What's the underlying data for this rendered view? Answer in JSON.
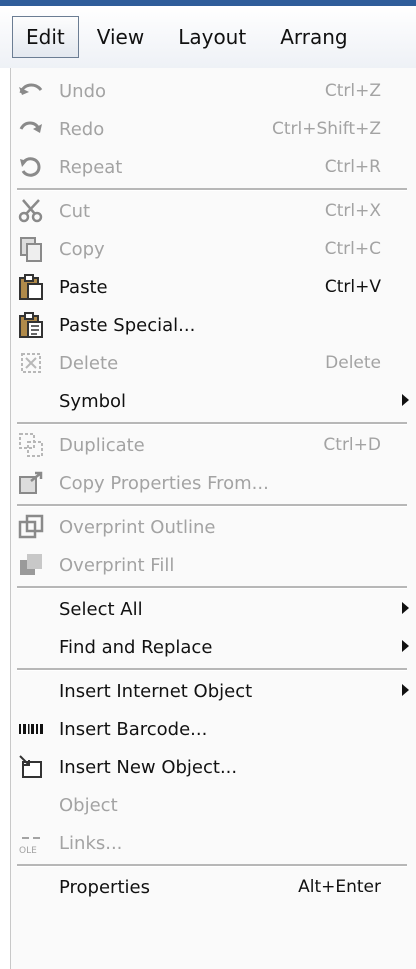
{
  "menubar": {
    "items": [
      {
        "label": "Edit"
      },
      {
        "label": "View"
      },
      {
        "label": "Layout"
      },
      {
        "label": "Arrang"
      }
    ]
  },
  "menu": {
    "items": [
      {
        "label": "Undo",
        "shortcut": "Ctrl+Z",
        "enabled": false,
        "icon": "undo-icon"
      },
      {
        "label": "Redo",
        "shortcut": "Ctrl+Shift+Z",
        "enabled": false,
        "icon": "redo-icon"
      },
      {
        "label": "Repeat",
        "shortcut": "Ctrl+R",
        "enabled": false,
        "icon": "repeat-icon"
      },
      {
        "label": "Cut",
        "shortcut": "Ctrl+X",
        "enabled": false,
        "icon": "scissors-icon"
      },
      {
        "label": "Copy",
        "shortcut": "Ctrl+C",
        "enabled": false,
        "icon": "copy-icon"
      },
      {
        "label": "Paste",
        "shortcut": "Ctrl+V",
        "enabled": true,
        "icon": "paste-icon"
      },
      {
        "label": "Paste Special...",
        "shortcut": "",
        "enabled": true,
        "icon": "paste-special-icon"
      },
      {
        "label": "Delete",
        "shortcut": "Delete",
        "enabled": false,
        "icon": "delete-icon"
      },
      {
        "label": "Symbol",
        "shortcut": "",
        "enabled": true,
        "submenu": true
      },
      {
        "label": "Duplicate",
        "shortcut": "Ctrl+D",
        "enabled": false,
        "icon": "duplicate-icon"
      },
      {
        "label": "Copy Properties From...",
        "shortcut": "",
        "enabled": false,
        "icon": "copy-properties-icon"
      },
      {
        "label": "Overprint Outline",
        "shortcut": "",
        "enabled": false,
        "icon": "overprint-outline-icon"
      },
      {
        "label": "Overprint Fill",
        "shortcut": "",
        "enabled": false,
        "icon": "overprint-fill-icon"
      },
      {
        "label": "Select All",
        "shortcut": "",
        "enabled": true,
        "submenu": true
      },
      {
        "label": "Find and Replace",
        "shortcut": "",
        "enabled": true,
        "submenu": true
      },
      {
        "label": "Insert Internet Object",
        "shortcut": "",
        "enabled": true,
        "submenu": true
      },
      {
        "label": "Insert Barcode...",
        "shortcut": "",
        "enabled": true,
        "icon": "barcode-icon"
      },
      {
        "label": "Insert New Object...",
        "shortcut": "",
        "enabled": true,
        "icon": "insert-object-icon"
      },
      {
        "label": "Object",
        "shortcut": "",
        "enabled": false
      },
      {
        "label": "Links...",
        "shortcut": "",
        "enabled": false,
        "icon": "ole-links-icon"
      },
      {
        "label": "Properties",
        "shortcut": "Alt+Enter",
        "enabled": true
      }
    ]
  },
  "colors": {
    "enabled_text": "#111111",
    "disabled_text": "#a3a3a3",
    "separator": "#b7b7b7",
    "accent": "#2f5d9a"
  }
}
